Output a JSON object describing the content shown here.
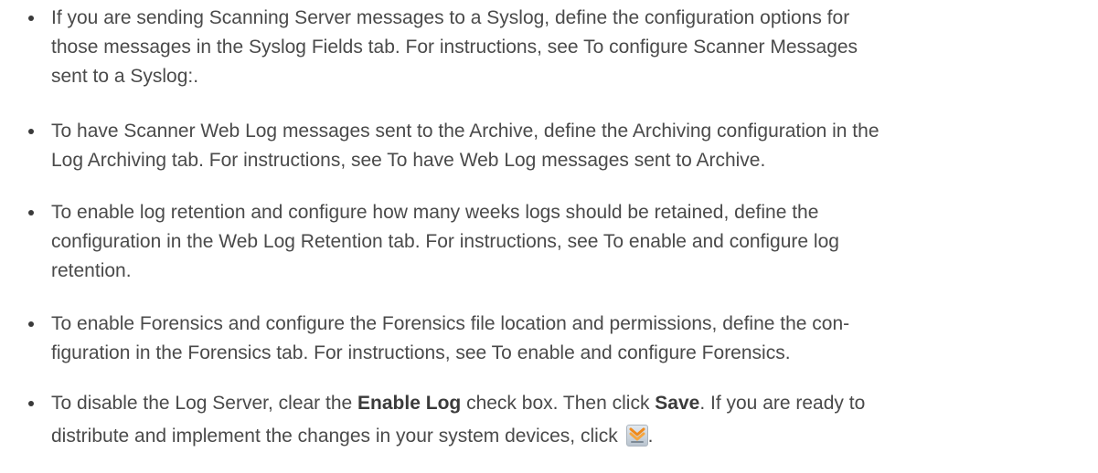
{
  "bullets": [
    {
      "lines": [
        "If you are sending Scanning Server messages to a Syslog, define the configuration options for",
        "those messages in the Syslog Fields tab. For instructions, see To configure Scanner Messages",
        "sent to a Syslog:."
      ]
    },
    {
      "lines": [
        "To have Scanner Web Log messages sent to the Archive, define the Archiving configuration in the",
        "Log Archiving tab. For instructions, see To have Web Log messages sent to Archive."
      ]
    },
    {
      "lines": [
        "To enable log retention and configure how many weeks logs should be retained, define the",
        "configuration in the Web Log Retention tab. For instructions, see To enable and configure log",
        "retention."
      ]
    },
    {
      "lines": [
        "To enable Forensics and configure the Forensics file location and permissions, define the con-",
        "figuration in the Forensics tab. For instructions, see To enable and configure Forensics."
      ]
    },
    {
      "line1_part1": "To disable the Log Server, clear the ",
      "line1_bold1": "Enable Log",
      "line1_part2": " check box. Then click ",
      "line1_bold2": "Save",
      "line1_part3": ". If you are ready to",
      "line2_text": "distribute and implement the changes in your system devices, click ",
      "line2_end": ".",
      "icon": "distribute-changes-icon"
    }
  ]
}
